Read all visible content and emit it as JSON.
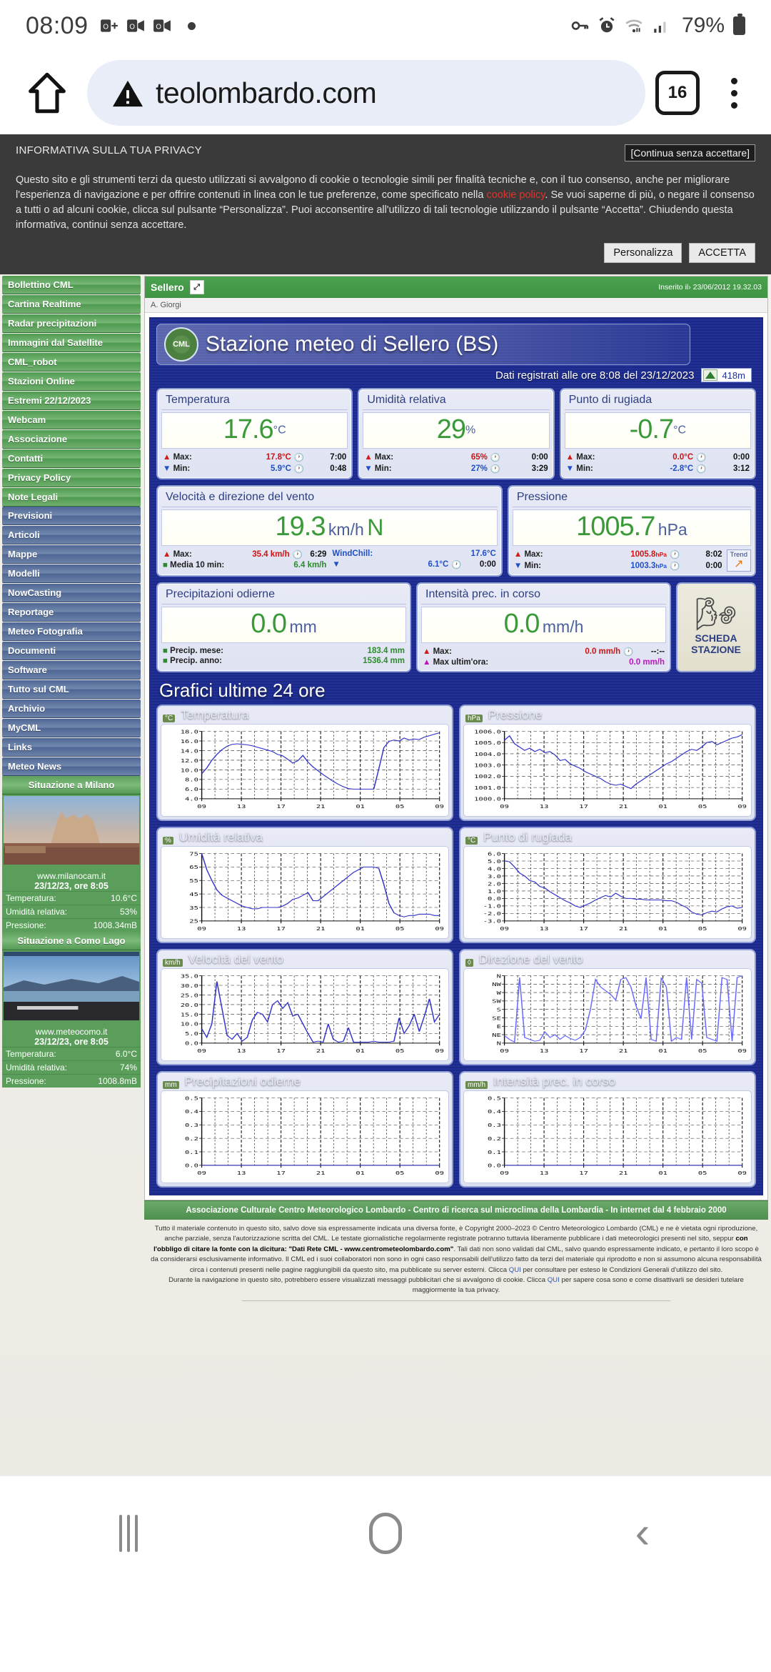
{
  "status_bar": {
    "time": "08:09",
    "icons": [
      "outlook-calendar-icon",
      "outlook-video-icon",
      "outlook-video-icon",
      "dot-icon"
    ],
    "battery_percent": "79%",
    "right_icons": [
      "vpn-key-icon",
      "alarm-icon",
      "wifi-icon",
      "signal-icon",
      "battery-icon"
    ]
  },
  "browser": {
    "home_icon": "home-icon",
    "security_icon": "not-secure-warning-icon",
    "url": "teolombardo.com",
    "tab_count": "16",
    "menu_icon": "kebab-menu-icon"
  },
  "cookie_banner": {
    "title": "INFORMATIVA SULLA TUA PRIVACY",
    "continue_label": "[Continua senza accettare]",
    "body_part1": "Questo sito e gli strumenti terzi da questo utilizzati si avvalgono di cookie o tecnologie simili per finalità tecniche e, con il tuo consenso, anche per migliorare l'esperienza di navigazione e per offrire contenuti in linea con le tue preferenze, come specificato nella ",
    "policy_link": "cookie policy",
    "body_part2": ". Se vuoi saperne di più, o negare il consenso a tutti o ad alcuni cookie, clicca sul pulsante “Personalizza”. Puoi acconsentire all'utilizzo di tali tecnologie utilizzando il pulsante “Accetta”. Chiudendo questa informativa, continui senza accettare.",
    "customize_label": "Personalizza",
    "accept_label": "ACCETTA"
  },
  "sidebar": {
    "green_items": [
      "Bollettino CML",
      "Cartina Realtime",
      "Radar precipitazioni",
      "Immagini dal Satellite",
      "CML_robot",
      "Stazioni Online",
      "Estremi 22/12/2023",
      "Webcam",
      "Associazione",
      "Contatti",
      "Privacy Policy",
      "Note Legali"
    ],
    "blue_items": [
      "Previsioni",
      "Articoli",
      "Mappe",
      "Modelli",
      "NowCasting",
      "Reportage",
      "Meteo Fotografia",
      "Documenti",
      "Software",
      "Tutto sul CML",
      "Archivio",
      "MyCML",
      "Links",
      "Meteo News"
    ],
    "widgets": [
      {
        "title": "Situazione a Milano",
        "source": "www.milanocam.it",
        "timestamp": "23/12/23, ore 8:05",
        "rows": [
          {
            "label": "Temperatura:",
            "value": "10.6°C"
          },
          {
            "label": "Umidità relativa:",
            "value": "53%"
          },
          {
            "label": "Pressione:",
            "value": "1008.34mB"
          }
        ]
      },
      {
        "title": "Situazione a Como Lago",
        "source": "www.meteocomo.it",
        "timestamp": "23/12/23, ore 8:05",
        "rows": [
          {
            "label": "Temperatura:",
            "value": "6.0°C"
          },
          {
            "label": "Umidità relativa:",
            "value": "74%"
          },
          {
            "label": "Pressione:",
            "value": "1008.8mB"
          }
        ]
      }
    ]
  },
  "article": {
    "header_title": "Sellero",
    "resize_icon": "fullscreen-icon",
    "inserted": "Inserito il› 23/06/2012 19.32.03",
    "author": "A. Giorgi"
  },
  "station": {
    "logo_text": "CML",
    "title": "Stazione meteo di Sellero (BS)",
    "subtitle": "Dati registrati alle ore 8:08 del 23/12/2023",
    "altitude": "418m",
    "altitude_icon": "mountain-icon"
  },
  "panels": [
    {
      "title": "Temperatura",
      "value": "17.6",
      "unit": "°C",
      "max_label": "Max:",
      "max_value": "17.8°C",
      "max_time": "7:00",
      "min_label": "Min:",
      "min_value": "5.9°C",
      "min_time": "0:48"
    },
    {
      "title": "Umidità relativa",
      "value": "29",
      "unit": "%",
      "max_label": "Max:",
      "max_value": "65%",
      "max_time": "0:00",
      "min_label": "Min:",
      "min_value": "27%",
      "min_time": "3:29"
    },
    {
      "title": "Punto di rugiada",
      "value": "-0.7",
      "unit": "°C",
      "max_label": "Max:",
      "max_value": "0.0°C",
      "max_time": "0:00",
      "min_label": "Min:",
      "min_value": "-2.8°C",
      "min_time": "3:12"
    }
  ],
  "wind": {
    "title": "Velocità e direzione del vento",
    "value": "19.3",
    "unit": "km/h",
    "direction": "N",
    "max_label": "Max:",
    "max_value": "35.4 km/h",
    "max_time": "6:29",
    "avg_label": "Media 10 min:",
    "avg_value": "6.4 km/h",
    "windchill_label": "WindChill:",
    "windchill_value": "17.6°C",
    "windchill_min": "6.1°C",
    "windchill_min_time": "0:00"
  },
  "pressure": {
    "title": "Pressione",
    "value": "1005.7",
    "unit": "hPa",
    "max_label": "Max:",
    "max_value": "1005.8",
    "max_unit": "hPa",
    "max_time": "8:02",
    "min_label": "Min:",
    "min_value": "1003.3",
    "min_unit": "hPa",
    "min_time": "0:00",
    "trend_label": "Trend",
    "trend_arrow": "↗"
  },
  "rain": {
    "title": "Precipitazioni odierne",
    "value": "0.0",
    "unit": "mm",
    "month_label": "Precip. mese:",
    "month_value": "183.4 mm",
    "year_label": "Precip. anno:",
    "year_value": "1536.4 mm"
  },
  "rain_rate": {
    "title": "Intensità prec. in corso",
    "value": "0.0",
    "unit": "mm/h",
    "max_label": "Max:",
    "max_value": "0.0 mm/h",
    "max_time": "--:--",
    "lasthour_label": "Max ultim'ora:",
    "lasthour_value": "0.0 mm/h"
  },
  "scheda": {
    "icon": "anemometer-icon",
    "line1": "SCHEDA",
    "line2": "STAZIONE"
  },
  "charts_title": "Grafici ultime 24 ore",
  "chart_data": [
    {
      "type": "line",
      "title": "Temperatura",
      "ylabel": "°C",
      "xlabel": "",
      "ylim": [
        4.0,
        18.0
      ],
      "yticks": [
        "18.0",
        "16.0",
        "14.0",
        "12.0",
        "10.0",
        "8.0",
        "6.0",
        "4.0"
      ],
      "xticks": [
        "09",
        "13",
        "17",
        "21",
        "01",
        "05",
        "09"
      ],
      "grid": true,
      "series": [
        {
          "name": "Temperatura",
          "color": "#3333cc",
          "values": [
            9.2,
            10.4,
            12.0,
            13.2,
            14.2,
            14.9,
            15.3,
            15.4,
            15.3,
            15.2,
            15.0,
            14.7,
            14.4,
            14.1,
            13.8,
            13.2,
            12.9,
            12.2,
            11.4,
            11.9,
            13.0,
            11.6,
            10.6,
            9.8,
            9.0,
            8.3,
            7.6,
            7.0,
            6.5,
            6.1,
            6.0,
            6.0,
            6.0,
            6.0,
            6.0,
            10.2,
            14.6,
            15.9,
            16.2,
            16.0,
            16.6,
            16.2,
            16.4,
            16.3,
            16.8,
            17.1,
            17.4,
            17.7
          ]
        }
      ]
    },
    {
      "type": "line",
      "title": "Pressione",
      "ylabel": "hPa",
      "xlabel": "",
      "ylim": [
        1000.0,
        1006.0
      ],
      "yticks": [
        "1006.0",
        "1005.0",
        "1004.0",
        "1003.0",
        "1002.0",
        "1001.0",
        "1000.0"
      ],
      "xticks": [
        "09",
        "13",
        "17",
        "21",
        "01",
        "05",
        "09"
      ],
      "grid": true,
      "series": [
        {
          "name": "Pressione",
          "color": "#3333cc",
          "values": [
            1005.2,
            1005.6,
            1004.9,
            1004.6,
            1004.3,
            1004.5,
            1004.2,
            1004.4,
            1004.1,
            1004.2,
            1003.9,
            1003.4,
            1003.5,
            1003.1,
            1002.9,
            1002.7,
            1002.4,
            1002.2,
            1002.0,
            1001.8,
            1001.5,
            1001.3,
            1001.2,
            1001.3,
            1001.1,
            1000.9,
            1001.3,
            1001.6,
            1001.9,
            1002.2,
            1002.5,
            1002.8,
            1003.1,
            1003.3,
            1003.6,
            1003.9,
            1004.2,
            1004.4,
            1004.3,
            1004.6,
            1005.0,
            1005.1,
            1004.8,
            1005.0,
            1005.2,
            1005.4,
            1005.5,
            1005.7
          ]
        }
      ]
    },
    {
      "type": "line",
      "title": "Umidità relativa",
      "ylabel": "%",
      "xlabel": "",
      "ylim": [
        25,
        75
      ],
      "yticks": [
        "75",
        "65",
        "55",
        "45",
        "35",
        "25"
      ],
      "xticks": [
        "09",
        "13",
        "17",
        "21",
        "01",
        "05",
        "09"
      ],
      "grid": true,
      "series": [
        {
          "name": "Umidità relativa",
          "color": "#3333cc",
          "values": [
            75,
            63,
            55,
            48,
            44,
            42,
            40,
            38,
            36,
            35,
            34,
            34,
            35,
            35,
            35,
            35,
            36,
            38,
            41,
            42,
            44,
            46,
            40,
            40,
            43,
            46,
            49,
            52,
            55,
            58,
            61,
            63,
            65,
            65,
            65,
            64,
            52,
            38,
            31,
            29,
            28,
            29,
            29,
            30,
            30,
            30,
            29,
            29
          ]
        }
      ]
    },
    {
      "type": "line",
      "title": "Punto di rugiada",
      "ylabel": "°C",
      "xlabel": "",
      "ylim": [
        -3.0,
        6.0
      ],
      "yticks": [
        "6.0",
        "5.0",
        "4.0",
        "3.0",
        "2.0",
        "1.0",
        "0.0",
        "-1.0",
        "-2.0",
        "-3.0"
      ],
      "xticks": [
        "09",
        "13",
        "17",
        "21",
        "01",
        "05",
        "09"
      ],
      "grid": true,
      "series": [
        {
          "name": "Punto di rugiada",
          "color": "#3333cc",
          "values": [
            5.0,
            4.9,
            4.2,
            3.4,
            3.0,
            2.4,
            2.2,
            1.6,
            1.4,
            0.9,
            0.5,
            0.1,
            -0.3,
            -0.6,
            -1.0,
            -1.2,
            -0.9,
            -0.6,
            -0.2,
            0.1,
            0.4,
            0.2,
            0.7,
            0.3,
            0.0,
            0.0,
            -0.1,
            -0.1,
            -0.2,
            -0.2,
            -0.2,
            -0.2,
            -0.3,
            -0.3,
            -0.5,
            -0.9,
            -1.2,
            -1.8,
            -2.1,
            -2.2,
            -1.9,
            -1.7,
            -1.8,
            -1.4,
            -1.1,
            -1.0,
            -1.3,
            -1.2
          ]
        }
      ]
    },
    {
      "type": "line",
      "title": "Velocità del vento",
      "ylabel": "km/h",
      "xlabel": "",
      "ylim": [
        0.0,
        35.0
      ],
      "yticks": [
        "35.0",
        "30.0",
        "25.0",
        "20.0",
        "15.0",
        "10.0",
        "5.0",
        "0.0"
      ],
      "xticks": [
        "09",
        "13",
        "17",
        "21",
        "01",
        "05",
        "09"
      ],
      "grid": true,
      "series": [
        {
          "name": "Velocità del vento",
          "color": "#3333cc",
          "values": [
            7.5,
            3.0,
            10.0,
            32.0,
            18.0,
            4.0,
            2.0,
            5.0,
            1.0,
            3.0,
            12.0,
            16.0,
            15.0,
            11.0,
            20.0,
            22.0,
            18.0,
            21.0,
            14.0,
            15.0,
            10.0,
            5.0,
            0.5,
            1.0,
            0.5,
            10.0,
            2.0,
            0.5,
            1.0,
            8.0,
            0.5,
            0.5,
            0.5,
            0.5,
            1.0,
            0.5,
            0.5,
            0.5,
            1.0,
            13.0,
            5.0,
            9.0,
            15.0,
            6.0,
            14.0,
            23.0,
            11.0,
            15.0
          ]
        }
      ]
    },
    {
      "type": "line",
      "title": "Direzione del vento",
      "ylabel": "◊",
      "xlabel": "",
      "ylim": [
        0,
        360
      ],
      "yticks": [
        "N",
        "NW",
        "W",
        "SW",
        "S",
        "SE",
        "E",
        "NE",
        "N"
      ],
      "xticks": [
        "09",
        "13",
        "17",
        "21",
        "01",
        "05",
        "09"
      ],
      "grid": true,
      "series": [
        {
          "name": "Direzione del vento",
          "color": "#6a6aff",
          "values": [
            40,
            20,
            5,
            350,
            30,
            20,
            10,
            15,
            60,
            30,
            45,
            20,
            40,
            25,
            15,
            30,
            70,
            180,
            340,
            300,
            280,
            260,
            230,
            340,
            350,
            300,
            200,
            130,
            350,
            20,
            10,
            350,
            300,
            10,
            30,
            20,
            350,
            20,
            340,
            320,
            30,
            20,
            10,
            350,
            340,
            10,
            350,
            360
          ]
        }
      ]
    },
    {
      "type": "line",
      "title": "Precipitazioni odierne",
      "ylabel": "mm",
      "xlabel": "",
      "ylim": [
        0.0,
        0.5
      ],
      "yticks": [
        "0.5",
        "0.4",
        "0.3",
        "0.2",
        "0.1",
        "0.0"
      ],
      "xticks": [
        "09",
        "13",
        "17",
        "21",
        "01",
        "05",
        "09"
      ],
      "grid": true,
      "series": [
        {
          "name": "Precipitazioni odierne",
          "color": "#3333cc",
          "values": [
            0,
            0,
            0,
            0,
            0,
            0,
            0,
            0,
            0,
            0,
            0,
            0,
            0,
            0,
            0,
            0,
            0,
            0,
            0,
            0,
            0,
            0,
            0,
            0,
            0,
            0,
            0,
            0,
            0,
            0,
            0,
            0,
            0,
            0,
            0,
            0,
            0,
            0,
            0,
            0,
            0,
            0,
            0,
            0,
            0,
            0,
            0,
            0
          ]
        }
      ]
    },
    {
      "type": "line",
      "title": "Intensità prec. in corso",
      "ylabel": "mm/h",
      "xlabel": "",
      "ylim": [
        0.0,
        0.5
      ],
      "yticks": [
        "0.5",
        "0.4",
        "0.3",
        "0.2",
        "0.1",
        "0.0"
      ],
      "xticks": [
        "09",
        "13",
        "17",
        "21",
        "01",
        "05",
        "09"
      ],
      "grid": true,
      "series": [
        {
          "name": "Intensità prec. in corso",
          "color": "#3333cc",
          "values": [
            0,
            0,
            0,
            0,
            0,
            0,
            0,
            0,
            0,
            0,
            0,
            0,
            0,
            0,
            0,
            0,
            0,
            0,
            0,
            0,
            0,
            0,
            0,
            0,
            0,
            0,
            0,
            0,
            0,
            0,
            0,
            0,
            0,
            0,
            0,
            0,
            0,
            0,
            0,
            0,
            0,
            0,
            0,
            0,
            0,
            0,
            0,
            0
          ]
        }
      ]
    }
  ],
  "footer": {
    "bar": "Associazione Culturale Centro Meteorologico Lombardo - Centro di ricerca sul microclima della Lombardia - In internet dal 4 febbraio 2000",
    "p1": "Tutto il materiale contenuto in questo sito, salvo dove sia espressamente indicata una diversa fonte, è Copyright 2000–2023 © Centro Meteorologico Lombardo (CML) e ne è vietata ogni riproduzione, anche parziale, senza l'autorizzazione scritta del CML. Le testate giornalistiche regolarmente registrate potranno tuttavia liberamente pubblicare i dati meteorologici presenti nel sito, seppur ",
    "p1b": "con l'obbligo di citare la fonte con la dicitura: \"Dati Rete CML - www.centrometeolombardo.com\"",
    "p1c": ". Tali dati non sono validati dal CML, salvo quando espressamente indicato, e pertanto il loro scopo è da considerarsi esclusivamente informativo. Il CML ed i suoi collaboratori non sono in ogni caso responsabili dell'utilizzo fatto da terzi del materiale qui riprodotto e non si assumono alcuna responsabilità circa i contenuti presenti nelle pagine raggiungibili da questo sito, ma pubblicate su server esterni. Clicca ",
    "link1": "QUI",
    "p1d": " per consultare per esteso le Condizioni Generali d'utilizzo del sito.",
    "p2a": "Durante la navigazione in questo sito, potrebbero essere visualizzati messaggi pubblicitari che si avvalgono di cookie. Clicca ",
    "link2": "QUI",
    "p2b": " per sapere cosa sono e come disattivarli se desideri tutelare maggiormente la tua privacy."
  },
  "navbar": {
    "recents": "recents-icon",
    "home": "home-nav-icon",
    "back": "back-icon"
  }
}
